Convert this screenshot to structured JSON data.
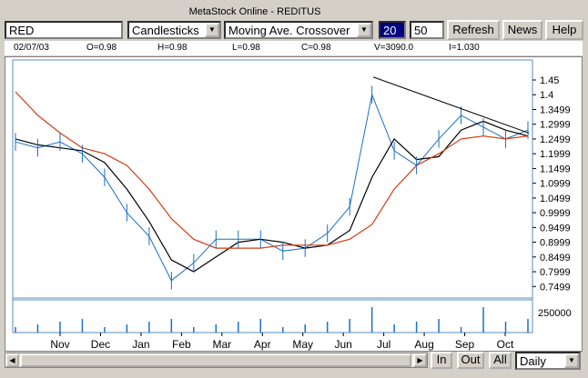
{
  "window": {
    "title": "MetaStock Online - REDITUS"
  },
  "toolbar": {
    "symbol": "RED",
    "chart_type": "Candlesticks",
    "indicator": "Moving Ave. Crossover",
    "param1": "20",
    "param2": "50",
    "refresh_label": "Refresh",
    "news_label": "News",
    "help_label": "Help"
  },
  "info": {
    "date": "02/07/03",
    "open": "O=0.98",
    "high": "H=0.98",
    "low": "L=0.98",
    "close": "C=0.98",
    "volume": "V=3090.0",
    "interest": "I=1.030"
  },
  "bottom": {
    "zoom_in_label": "In",
    "zoom_out_label": "Out",
    "all_label": "All",
    "period": "Daily"
  },
  "colors": {
    "price": "#1c6fc4",
    "ma_short": "#000000",
    "ma_long": "#d43a12",
    "trendline": "#000000"
  },
  "chart_data": {
    "type": "line",
    "x": [
      "Nov",
      "Dec",
      "Jan",
      "Feb",
      "Mar",
      "Apr",
      "May",
      "Jun",
      "Jul",
      "Aug",
      "Sep",
      "Oct"
    ],
    "y_ticks": [
      "1.45",
      "1.4",
      "1.3499",
      "1.2999",
      "1.2499",
      "1.1999",
      "1.1499",
      "1.0999",
      "1.0499",
      "0.9999",
      "0.9499",
      "0.8999",
      "0.8499",
      "0.7999",
      "0.7499"
    ],
    "ylim": [
      0.72,
      1.49
    ],
    "volume_label": "250000",
    "series": [
      {
        "values": [
          1.24,
          1.22,
          1.24,
          1.2,
          1.12,
          1.0,
          0.92,
          0.77,
          0.83,
          0.91,
          0.91,
          0.91,
          0.87,
          0.88,
          0.93,
          1.02,
          1.4,
          1.21,
          1.16,
          1.25,
          1.33,
          1.29,
          1.25,
          1.28
        ]
      },
      {
        "values": [
          1.25,
          1.23,
          1.22,
          1.21,
          1.17,
          1.08,
          0.97,
          0.84,
          0.8,
          0.85,
          0.9,
          0.91,
          0.9,
          0.88,
          0.89,
          0.94,
          1.12,
          1.25,
          1.18,
          1.19,
          1.28,
          1.31,
          1.28,
          1.26
        ]
      },
      {
        "values": [
          1.41,
          1.33,
          1.27,
          1.22,
          1.2,
          1.16,
          1.08,
          0.98,
          0.91,
          0.88,
          0.88,
          0.88,
          0.89,
          0.89,
          0.89,
          0.91,
          0.96,
          1.08,
          1.16,
          1.2,
          1.25,
          1.26,
          1.25,
          1.26
        ]
      },
      {
        "values": [
          1.46,
          1.27
        ]
      }
    ]
  }
}
